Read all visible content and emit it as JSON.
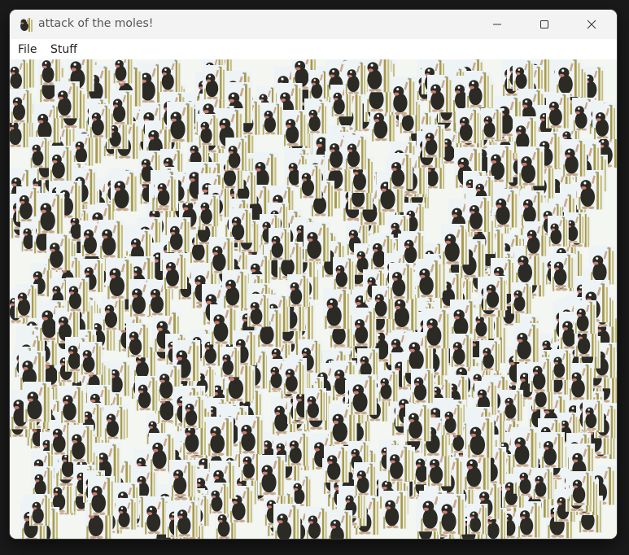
{
  "window": {
    "title": "attack of the moles!",
    "controls": {
      "minimize": "minimize-icon",
      "maximize": "maximize-icon",
      "close": "close-icon"
    }
  },
  "menubar": {
    "items": [
      {
        "label": "File"
      },
      {
        "label": "Stuff"
      }
    ]
  },
  "canvas": {
    "sprite": "mole-icon",
    "colors": {
      "background": "#f4f6f2",
      "mole_body": "#2b2a24",
      "mole_belly": "#c9a98a",
      "grass": "#a89a4a",
      "grass_light": "#c7bf7a",
      "card_bg": "#eef3f6"
    }
  }
}
